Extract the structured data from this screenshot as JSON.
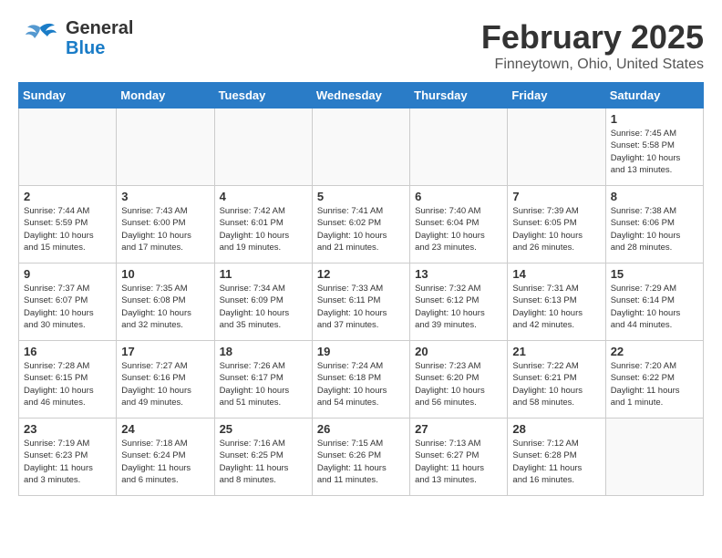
{
  "header": {
    "logo_general": "General",
    "logo_blue": "Blue",
    "month_year": "February 2025",
    "location": "Finneytown, Ohio, United States"
  },
  "weekdays": [
    "Sunday",
    "Monday",
    "Tuesday",
    "Wednesday",
    "Thursday",
    "Friday",
    "Saturday"
  ],
  "weeks": [
    [
      {
        "day": "",
        "info": ""
      },
      {
        "day": "",
        "info": ""
      },
      {
        "day": "",
        "info": ""
      },
      {
        "day": "",
        "info": ""
      },
      {
        "day": "",
        "info": ""
      },
      {
        "day": "",
        "info": ""
      },
      {
        "day": "1",
        "info": "Sunrise: 7:45 AM\nSunset: 5:58 PM\nDaylight: 10 hours\nand 13 minutes."
      }
    ],
    [
      {
        "day": "2",
        "info": "Sunrise: 7:44 AM\nSunset: 5:59 PM\nDaylight: 10 hours\nand 15 minutes."
      },
      {
        "day": "3",
        "info": "Sunrise: 7:43 AM\nSunset: 6:00 PM\nDaylight: 10 hours\nand 17 minutes."
      },
      {
        "day": "4",
        "info": "Sunrise: 7:42 AM\nSunset: 6:01 PM\nDaylight: 10 hours\nand 19 minutes."
      },
      {
        "day": "5",
        "info": "Sunrise: 7:41 AM\nSunset: 6:02 PM\nDaylight: 10 hours\nand 21 minutes."
      },
      {
        "day": "6",
        "info": "Sunrise: 7:40 AM\nSunset: 6:04 PM\nDaylight: 10 hours\nand 23 minutes."
      },
      {
        "day": "7",
        "info": "Sunrise: 7:39 AM\nSunset: 6:05 PM\nDaylight: 10 hours\nand 26 minutes."
      },
      {
        "day": "8",
        "info": "Sunrise: 7:38 AM\nSunset: 6:06 PM\nDaylight: 10 hours\nand 28 minutes."
      }
    ],
    [
      {
        "day": "9",
        "info": "Sunrise: 7:37 AM\nSunset: 6:07 PM\nDaylight: 10 hours\nand 30 minutes."
      },
      {
        "day": "10",
        "info": "Sunrise: 7:35 AM\nSunset: 6:08 PM\nDaylight: 10 hours\nand 32 minutes."
      },
      {
        "day": "11",
        "info": "Sunrise: 7:34 AM\nSunset: 6:09 PM\nDaylight: 10 hours\nand 35 minutes."
      },
      {
        "day": "12",
        "info": "Sunrise: 7:33 AM\nSunset: 6:11 PM\nDaylight: 10 hours\nand 37 minutes."
      },
      {
        "day": "13",
        "info": "Sunrise: 7:32 AM\nSunset: 6:12 PM\nDaylight: 10 hours\nand 39 minutes."
      },
      {
        "day": "14",
        "info": "Sunrise: 7:31 AM\nSunset: 6:13 PM\nDaylight: 10 hours\nand 42 minutes."
      },
      {
        "day": "15",
        "info": "Sunrise: 7:29 AM\nSunset: 6:14 PM\nDaylight: 10 hours\nand 44 minutes."
      }
    ],
    [
      {
        "day": "16",
        "info": "Sunrise: 7:28 AM\nSunset: 6:15 PM\nDaylight: 10 hours\nand 46 minutes."
      },
      {
        "day": "17",
        "info": "Sunrise: 7:27 AM\nSunset: 6:16 PM\nDaylight: 10 hours\nand 49 minutes."
      },
      {
        "day": "18",
        "info": "Sunrise: 7:26 AM\nSunset: 6:17 PM\nDaylight: 10 hours\nand 51 minutes."
      },
      {
        "day": "19",
        "info": "Sunrise: 7:24 AM\nSunset: 6:18 PM\nDaylight: 10 hours\nand 54 minutes."
      },
      {
        "day": "20",
        "info": "Sunrise: 7:23 AM\nSunset: 6:20 PM\nDaylight: 10 hours\nand 56 minutes."
      },
      {
        "day": "21",
        "info": "Sunrise: 7:22 AM\nSunset: 6:21 PM\nDaylight: 10 hours\nand 58 minutes."
      },
      {
        "day": "22",
        "info": "Sunrise: 7:20 AM\nSunset: 6:22 PM\nDaylight: 11 hours\nand 1 minute."
      }
    ],
    [
      {
        "day": "23",
        "info": "Sunrise: 7:19 AM\nSunset: 6:23 PM\nDaylight: 11 hours\nand 3 minutes."
      },
      {
        "day": "24",
        "info": "Sunrise: 7:18 AM\nSunset: 6:24 PM\nDaylight: 11 hours\nand 6 minutes."
      },
      {
        "day": "25",
        "info": "Sunrise: 7:16 AM\nSunset: 6:25 PM\nDaylight: 11 hours\nand 8 minutes."
      },
      {
        "day": "26",
        "info": "Sunrise: 7:15 AM\nSunset: 6:26 PM\nDaylight: 11 hours\nand 11 minutes."
      },
      {
        "day": "27",
        "info": "Sunrise: 7:13 AM\nSunset: 6:27 PM\nDaylight: 11 hours\nand 13 minutes."
      },
      {
        "day": "28",
        "info": "Sunrise: 7:12 AM\nSunset: 6:28 PM\nDaylight: 11 hours\nand 16 minutes."
      },
      {
        "day": "",
        "info": ""
      }
    ]
  ]
}
